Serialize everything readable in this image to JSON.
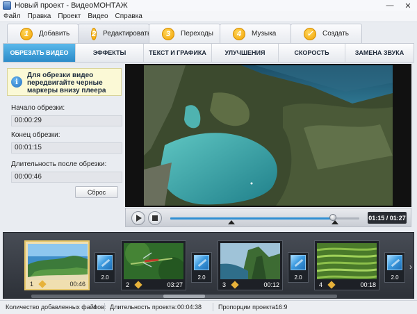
{
  "window": {
    "title": "Новый проект - ВидеоМОНТАЖ",
    "minimize": "—",
    "close": "✕"
  },
  "menu": [
    "Файл",
    "Правка",
    "Проект",
    "Видео",
    "Справка"
  ],
  "steps": [
    {
      "num": "1",
      "label": "Добавить"
    },
    {
      "num": "2",
      "label": "Редактировать"
    },
    {
      "num": "3",
      "label": "Переходы"
    },
    {
      "num": "4",
      "label": "Музыка"
    },
    {
      "num": "✓",
      "label": "Создать"
    }
  ],
  "subtabs": [
    "ОБРЕЗАТЬ ВИДЕО",
    "ЭФФЕКТЫ",
    "ТЕКСТ И ГРАФИКА",
    "УЛУЧШЕНИЯ",
    "СКОРОСТЬ",
    "ЗАМЕНА ЗВУКА"
  ],
  "trim": {
    "tip": "Для обрезки видео передвигайте черные маркеры внизу плеера",
    "start_label": "Начало обрезки:",
    "start_value": "00:00:29",
    "end_label": "Конец обрезки:",
    "end_value": "00:01:15",
    "duration_label": "Длительность после обрезки:",
    "duration_value": "00:00:46",
    "reset_label": "Сброс"
  },
  "player": {
    "time": "01:15 / 01:27",
    "progress": 0.862
  },
  "clips": [
    {
      "num": "1",
      "duration": "00:46"
    },
    {
      "num": "2",
      "duration": "03:27"
    },
    {
      "num": "3",
      "duration": "00:12"
    },
    {
      "num": "4",
      "duration": "00:18"
    }
  ],
  "transitions": [
    "2.0",
    "2.0",
    "2.0",
    "2.0"
  ],
  "status": {
    "files_label": "Количество добавленных файлов:",
    "files_value": "4",
    "project_duration_label": "Длительность проекта:",
    "project_duration_value": "00:04:38",
    "ratio_label": "Пропорции проекта:",
    "ratio_value": "16:9"
  }
}
